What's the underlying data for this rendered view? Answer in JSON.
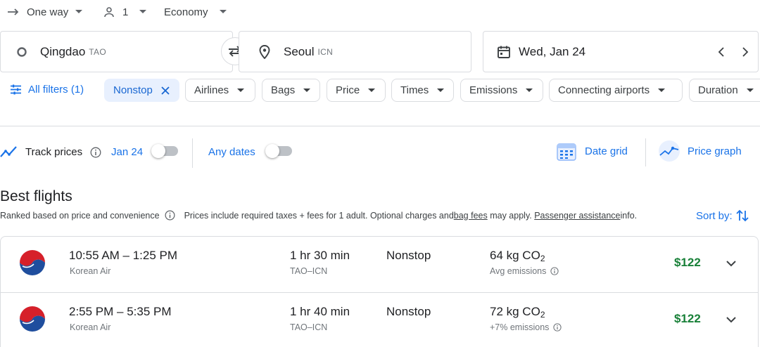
{
  "trip": {
    "type": "One way",
    "passengers": "1",
    "cabin": "Economy"
  },
  "search": {
    "origin_city": "Qingdao",
    "origin_code": "TAO",
    "destination_city": "Seoul",
    "destination_code": "ICN",
    "date": "Wed, Jan 24"
  },
  "filters": {
    "all_filters": "All filters (1)",
    "chips": [
      "Nonstop",
      "Airlines",
      "Bags",
      "Price",
      "Times",
      "Emissions",
      "Connecting airports",
      "Duration"
    ]
  },
  "track": {
    "label": "Track prices",
    "date": "Jan 24",
    "any_dates": "Any dates",
    "date_grid": "Date grid",
    "price_graph": "Price graph"
  },
  "results": {
    "title": "Best flights",
    "subtitle": "Ranked based on price and convenience",
    "info_prefix": "Prices include required taxes + fees for 1 adult. Optional charges and ",
    "bag_fees": "bag fees",
    "info_mid": " may apply. ",
    "passenger_assistance": "Passenger assistance",
    "info_suffix": " info.",
    "sort_by": "Sort by:"
  },
  "flights": [
    {
      "time": "10:55 AM – 1:25 PM",
      "airline": "Korean Air",
      "duration": "1 hr 30 min",
      "route": "TAO–ICN",
      "stops": "Nonstop",
      "co2_value": "64 kg CO",
      "co2_sub": "2",
      "emissions_note": "Avg emissions",
      "price": "$122"
    },
    {
      "time": "2:55 PM – 5:35 PM",
      "airline": "Korean Air",
      "duration": "1 hr 40 min",
      "route": "TAO–ICN",
      "stops": "Nonstop",
      "co2_value": "72 kg CO",
      "co2_sub": "2",
      "emissions_note": "+7% emissions",
      "price": "$122"
    }
  ],
  "colors": {
    "accent_blue": "#1a73e8",
    "chip_active_bg": "#e8f0fe",
    "price_green": "#188038",
    "text_secondary": "#70757a",
    "border": "#dadce0"
  },
  "icons": [
    "arrow-right-icon",
    "person-icon",
    "origin-circle-icon",
    "swap-icon",
    "location-pin-icon",
    "calendar-icon",
    "chevron-left-icon",
    "chevron-right-icon",
    "filter-sliders-icon",
    "close-icon",
    "chevron-down-icon",
    "trend-icon",
    "info-icon",
    "date-grid-icon",
    "price-graph-icon",
    "sort-icon",
    "korean-air-logo"
  ]
}
